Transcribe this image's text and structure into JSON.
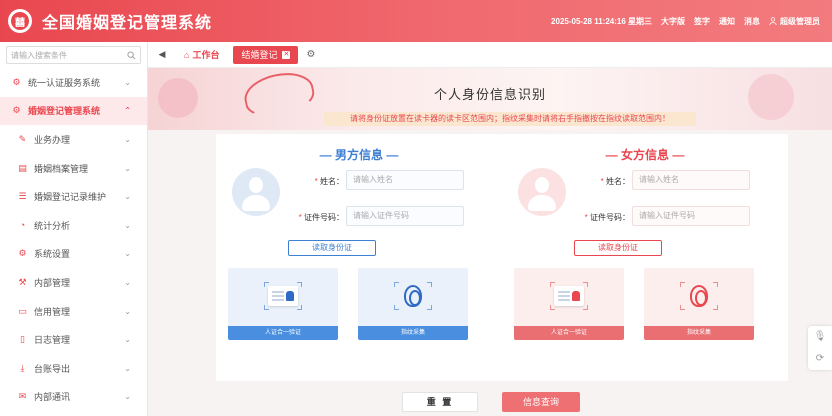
{
  "header": {
    "logo_char": "囍",
    "title": "全国婚姻登记管理系统",
    "datetime": "2025-05-28 11:24:16 星期三",
    "actions": [
      "大字版",
      "签字",
      "通知",
      "消息"
    ],
    "user": "超级管理员"
  },
  "sidebar": {
    "search_placeholder": "请输入搜索条件",
    "items": [
      {
        "label": "统一认证服务系统",
        "icon": "gear-icon"
      },
      {
        "label": "婚姻登记管理系统",
        "icon": "gear-icon"
      },
      {
        "label": "业务办理",
        "icon": "edit-icon"
      },
      {
        "label": "婚姻档案管理",
        "icon": "folder-icon"
      },
      {
        "label": "婚姻登记记录维护",
        "icon": "list-icon"
      },
      {
        "label": "统计分析",
        "icon": "pie-icon"
      },
      {
        "label": "系统设置",
        "icon": "gear-icon"
      },
      {
        "label": "内部管理",
        "icon": "wrench-icon"
      },
      {
        "label": "信用管理",
        "icon": "card-icon"
      },
      {
        "label": "日志管理",
        "icon": "file-icon"
      },
      {
        "label": "台账导出",
        "icon": "download-icon"
      },
      {
        "label": "内部通讯",
        "icon": "mail-icon"
      }
    ]
  },
  "tabs": {
    "home": "工作台",
    "active": "结婚登记"
  },
  "main": {
    "heading": "个人身份信息识别",
    "notice": "请将身份证放置在读卡器的读卡区范围内；指纹采集时请将右手指撤按在指纹读取范围内！",
    "male": {
      "title": "— 男方信息 —",
      "name_label": "姓名：",
      "name_placeholder": "请输入姓名",
      "id_label": "证件号码：",
      "id_placeholder": "请输入证件号码",
      "read_button": "读取身份证",
      "card1": "人证合一验证",
      "card2": "指纹采集"
    },
    "female": {
      "title": "— 女方信息 —",
      "name_label": "姓名：",
      "name_placeholder": "请输入姓名",
      "id_label": "证件号码：",
      "id_placeholder": "请输入证件号码",
      "read_button": "读取身份证",
      "card1": "人证合一验证",
      "card2": "指纹采集"
    },
    "reset_button": "重 置",
    "query_button": "信息查询"
  },
  "colors": {
    "brand": "#e9474f",
    "male_accent": "#3d7fd3",
    "female_accent": "#e9474f"
  }
}
